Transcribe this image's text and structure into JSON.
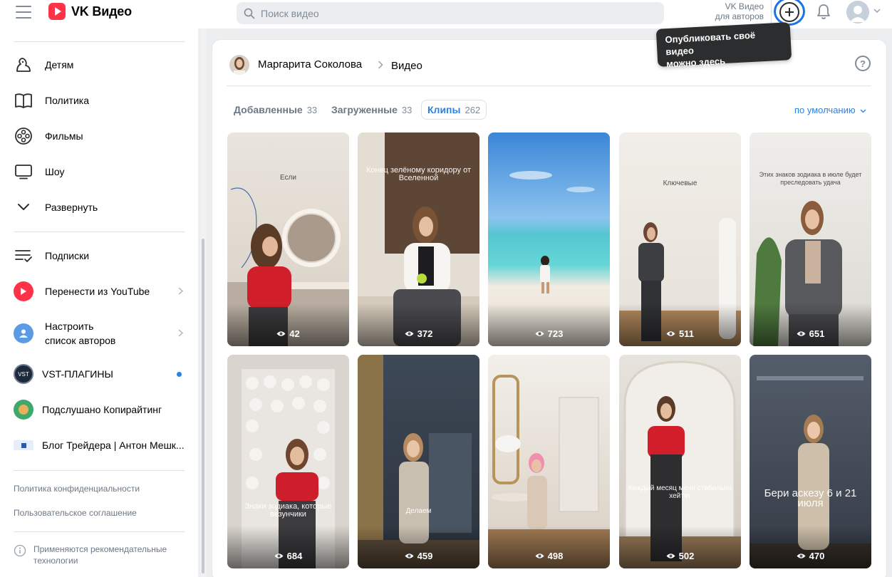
{
  "header": {
    "logo_text": "VK Видео",
    "search_placeholder": "Поиск видео",
    "authors_line1": "VK Видео",
    "authors_line2": "для авторов"
  },
  "tooltip": {
    "line1": "Опубликовать своё видео",
    "line2": "можно здесь"
  },
  "sidebar": {
    "items": [
      {
        "label": "Детям",
        "icon": "kids-icon"
      },
      {
        "label": "Политика",
        "icon": "book-icon"
      },
      {
        "label": "Фильмы",
        "icon": "film-reel-icon"
      },
      {
        "label": "Шоу",
        "icon": "tv-icon"
      },
      {
        "label": "Развернуть",
        "icon": "chevron-down-icon"
      }
    ],
    "subscriptions": "Подписки",
    "import_youtube": "Перенести из YouTube",
    "configure_line1": "Настроить",
    "configure_line2": "список авторов",
    "channels": [
      {
        "label": "VST-ПЛАГИНЫ"
      },
      {
        "label": "Подслушано Копирайтинг"
      },
      {
        "label": "Блог Трейдера | Антон Мешк..."
      }
    ],
    "privacy": "Политика конфиденциальности",
    "terms": "Пользовательское соглашение",
    "recommend_note": "Применяются рекомендательные технологии"
  },
  "page": {
    "owner": "Маргарита Соколова",
    "section": "Видео",
    "help": "?",
    "tabs": [
      {
        "label": "Добавленные",
        "count": "33"
      },
      {
        "label": "Загруженные",
        "count": "33"
      },
      {
        "label": "Клипы",
        "count": "262"
      }
    ],
    "sort": "по умолчанию"
  },
  "clips": [
    {
      "views": "42",
      "caption": "Если"
    },
    {
      "views": "372",
      "caption": "Конец зелёному коридору от Вселенной"
    },
    {
      "views": "723",
      "caption": ""
    },
    {
      "views": "511",
      "caption": "Ключевые"
    },
    {
      "views": "651",
      "caption": "Этих знаков зодиака в июле будет преследовать удача"
    },
    {
      "views": "684",
      "caption": "Знаки зодиака, которые везунчики"
    },
    {
      "views": "459",
      "caption": "Делаем"
    },
    {
      "views": "498",
      "caption": ""
    },
    {
      "views": "502",
      "caption": "Каждый месяц меня стабильно хейтят"
    },
    {
      "views": "470",
      "caption": "Бери аскезу 6 и 21 июля"
    }
  ],
  "colors": {
    "accent": "#2d81e0",
    "brand_red": "#ff3347",
    "highlight_ring": "#1a73e8"
  }
}
